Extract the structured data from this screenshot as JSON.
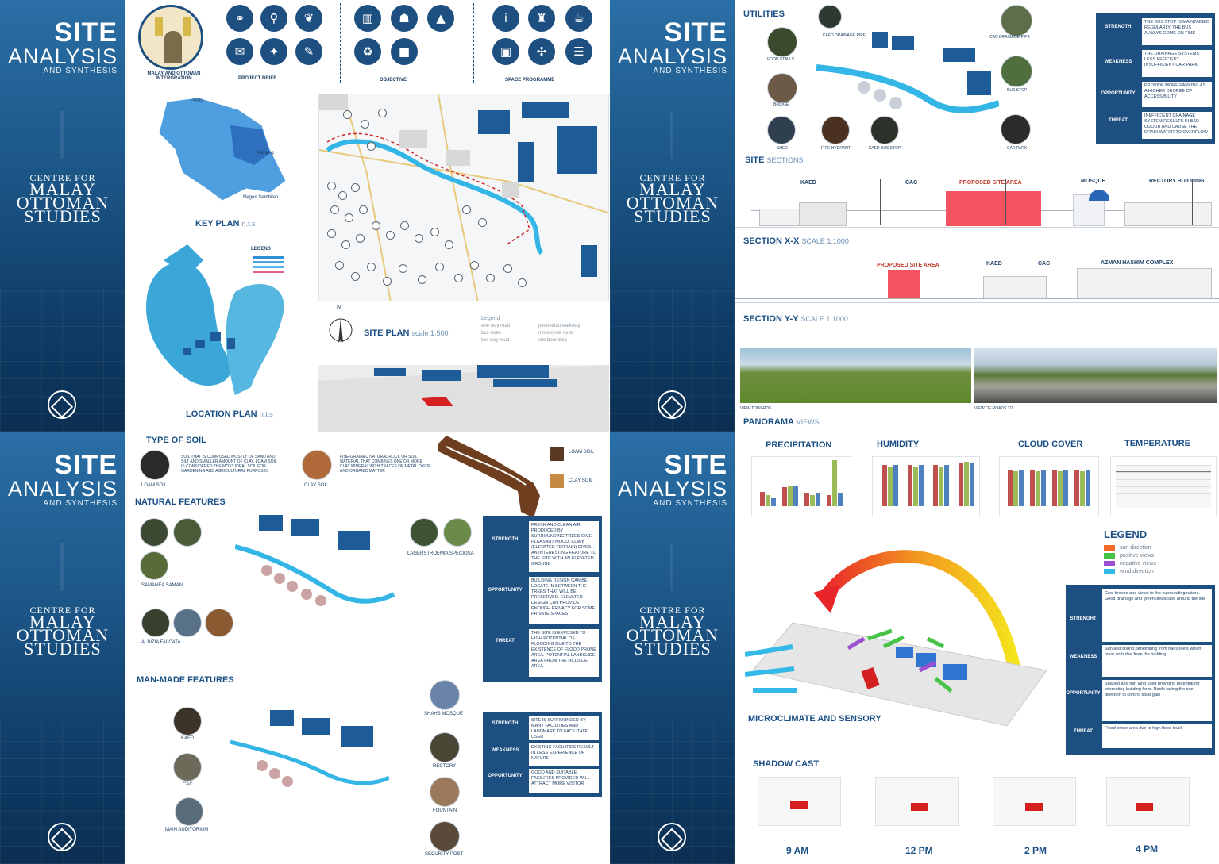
{
  "sidebar": {
    "title1": "SITE",
    "title2": "ANALYSIS",
    "title3": "AND SYNTHESIS",
    "centre1": "CENTRE FOR",
    "centre2": "MALAY",
    "centre3": "OTTOMAN",
    "centre4": "STUDIES"
  },
  "q1": {
    "concept_label": "MALAY AND OTTOMAN INTERGRATION",
    "project_brief": "PROJECT BRIEF",
    "objective": "OBJECTIVE",
    "space_programme": "SPACE PROGRAMME",
    "key_plan": "KEY PLAN",
    "key_plan_scale": "n.t.s",
    "location_plan": "LOCATION PLAN",
    "location_plan_scale": "n.t.s",
    "legend_title": "LEGEND",
    "site_plan": "SITE PLAN",
    "site_plan_scale": "scale 1:500",
    "north": "N",
    "site_legend_title": "Legend",
    "site_legend": [
      "one way road",
      "bus route",
      "two way road",
      "pedestrian walkway",
      "motorcycle route",
      "site boundary"
    ],
    "keymap_labels": [
      "Perlis",
      "Pahang",
      "Negeri Sembilan"
    ]
  },
  "q2": {
    "utilities": "UTILITIES",
    "util_labels": [
      "KAED DRAINAGE PIPE",
      "CAC DRAINAGE PIPE",
      "FOOD STALLS",
      "BRIDGE",
      "BUS STOP",
      "SHED",
      "FIRE HYDRANT",
      "KAED BUS STOP",
      "CAR PARK"
    ],
    "swot": [
      {
        "label": "STRENGTH",
        "text": "THE BUS STOP IS MAINTAINED REGULARLY. THE BUS ALWAYS COME ON TIME"
      },
      {
        "label": "WEAKNESS",
        "text": "THE DRAINAGE SYSTEMS LESS EFFICIENT. INSUFFICIENT CAR PARK"
      },
      {
        "label": "OPPORTUNITY",
        "text": "PROVIDE MORE PARKING AS A HIGHER DEGREE OF ACCESSIBILITY"
      },
      {
        "label": "THREAT",
        "text": "INEFFICIENT DRAINAGE SYSTEM RESULTS IN BAD ODOUR AND CAUSE THE DRAIN WATER TO OVERFLOW"
      }
    ],
    "site_sections": "SITE",
    "site_sections_sub": "SECTIONS",
    "sec1_labels": [
      "KAED",
      "CAC",
      "PROPOSED SITE AREA",
      "MOSQUE",
      "RECTORY BUILDING"
    ],
    "sec_xx": "SECTION X-X",
    "sec_xx_scale": "SCALE 1:1000",
    "sec2_labels": [
      "PROPOSED SITE AREA",
      "KAED",
      "CAC",
      "AZMAN HASHIM COMPLEX"
    ],
    "sec_yy": "SECTION Y-Y",
    "sec_yy_scale": "SCALE 1:1000",
    "pano_cap1": "VIEW TOWARDS",
    "pano_cap2": "VIEW OF ROADS TO",
    "panorama": "PANORAMA",
    "panorama_sub": "VIEWS"
  },
  "q3": {
    "type_of_soil": "TYPE OF SOIL",
    "loam_text": "SOIL THAT IS COMPOSED MOSTLY OF SAND AND SILT AND SMALLER AMOUNT OF CLAY. LOAM SOIL IS CONSIDERED THE MOST IDEAL SOIL FOR GARDENING AND AGRICULTURAL PURPOSES",
    "loam_cap": "LOAM SOIL",
    "clay_text": "FINE-GRAINED NATURAL ROCK OR SOIL MATERIAL THAT COMBINES ONE OR MORE CLAY MINERAL WITH TRACES OF METAL OXIDE AND ORGANIC MATTER",
    "clay_cap": "CLAY SOIL",
    "legend_loam": "LOAM SOIL",
    "legend_clay": "CLAY SOIL",
    "natural": "NATURAL FEATURES",
    "nat_labels": [
      "SAMANEA SAMAN",
      "ALBIZIA FALCATA",
      "LAGERSTROEMIA SPECIOSA"
    ],
    "nat_swot": [
      {
        "label": "STRENGTH",
        "text": "FRESH AND CLEAN AIR PRODUCED BY SURROUNDING TREES GIVE PLEASANT MOOD. CLIMB (ELEVATED TERRAIN) GIVES AN INTERESTING FEATURE TO THE SITE WITH AN ELEVATED GROUND"
      },
      {
        "label": "OPPORTUNITY",
        "text": "BUILDING DESIGN CAN BE LOCATE IN BETWEEN THE TREES THAT WILL BE PRESERVED. ELEVATED DESIGN CAN PROVIDE ENOUGH PRIVACY FOR SOME PRIVATE SPACES"
      },
      {
        "label": "THREAT",
        "text": "THE SITE IS EXPOSED TO HIGH POTENTIAL OF FLOODING DUE TO THE EXISTENCE OF FLOOD PRONE AREA. POTENTIAL LANDSLIDE AREA FROM THE HILLSIDE AREA"
      }
    ],
    "manmade": "MAN-MADE FEATURES",
    "man_labels": [
      "KAED",
      "CAC",
      "MAIN AUDITORIUM",
      "SHAHS MOSQUE",
      "RECTORY",
      "FOUNTAIN",
      "SECURITY POST"
    ],
    "man_swot": [
      {
        "label": "STRENGTH",
        "text": "SITE IS SURROUNDED BY MANY FACILITIES AND LANDMARK TO FACILITATE USER"
      },
      {
        "label": "WEAKNESS",
        "text": "EXISTING FACILITIES RESULT IN LESS EXPERIENCE OF NATURE"
      },
      {
        "label": "OPPORTUNITY",
        "text": "GOOD AND SUITABLE FACILITIES PROVIDED WILL ATTRACT MORE VISITOR"
      }
    ]
  },
  "q4": {
    "precipitation": "PRECIPITATION",
    "humidity": "HUMIDITY",
    "cloud": "CLOUD COVER",
    "temperature": "TEMPERATURE",
    "legend_title": "LEGEND",
    "legend_items": [
      {
        "label": "sun direction",
        "color": "#f06a2a"
      },
      {
        "label": "positive views",
        "color": "#47c447"
      },
      {
        "label": "negative views",
        "color": "#9b4fd1"
      },
      {
        "label": "wind direction",
        "color": "#35b9e8"
      }
    ],
    "micro": "MICROCLIMATE AND SENSORY",
    "swot": [
      {
        "label": "STRENGHT",
        "text": "Cool breeze and views to the surrounding nature. Good drainage and green landscape around the site"
      },
      {
        "label": "WEAKNESS",
        "text": "Sun and sound penetrating from the streets which have no buffer from the building"
      },
      {
        "label": "OPPORTUNITY",
        "text": "Shaped and thin land used providing potential for interesting building form. Roofs facing the sun direction to control solar gain"
      },
      {
        "label": "THREAT",
        "text": "Flood prone area due to high flood level"
      }
    ],
    "shadow_cast": "SHADOW CAST",
    "times": [
      "9 AM",
      "12 PM",
      "2 PM",
      "4 PM"
    ]
  }
}
